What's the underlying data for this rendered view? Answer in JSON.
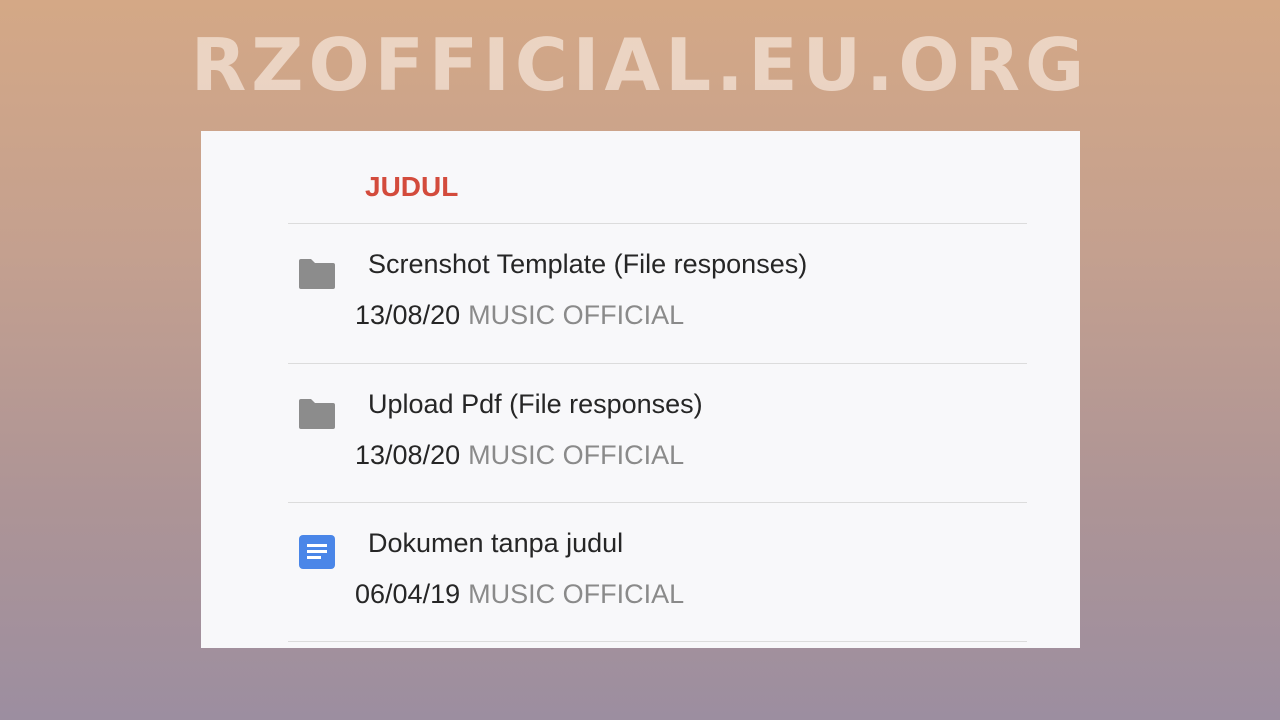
{
  "watermark": "RZOFFICIAL.EU.ORG",
  "list_header": "JUDUL",
  "files": [
    {
      "name": "Screnshot Template (File responses)",
      "date": "13/08/20",
      "owner": "MUSIC OFFICIAL",
      "icon": "folder-icon"
    },
    {
      "name": "Upload Pdf (File responses)",
      "date": "13/08/20",
      "owner": "MUSIC OFFICIAL",
      "icon": "folder-icon"
    },
    {
      "name": "Dokumen tanpa judul",
      "date": "06/04/19",
      "owner": "MUSIC OFFICIAL",
      "icon": "google-docs-icon"
    }
  ],
  "colors": {
    "header": "#d34b3c",
    "folder_icon": "#8c8c8c",
    "docs_icon": "#4a86e8",
    "owner_text": "#8a8a8a"
  }
}
